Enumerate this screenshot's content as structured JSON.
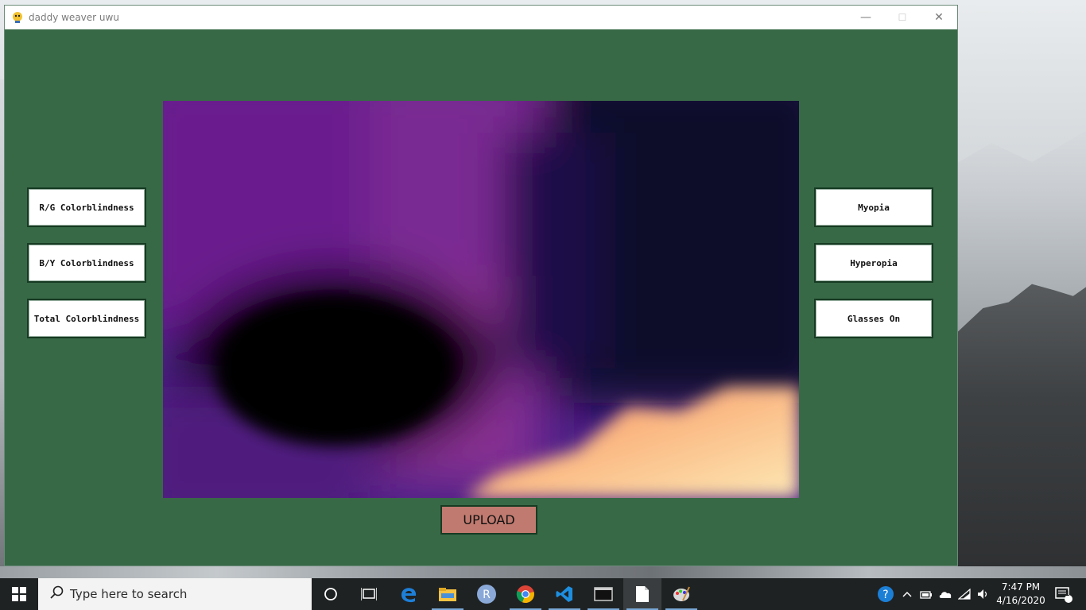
{
  "window": {
    "title": "daddy weaver uwu",
    "controls": {
      "minimize": "—",
      "maximize": "☐",
      "close": "✕"
    }
  },
  "app": {
    "background": "#386947",
    "left_buttons": [
      "R/G Colorblindness",
      "B/Y Colorblindness",
      "Total Colorblindness"
    ],
    "right_buttons": [
      "Myopia",
      "Hyperopia",
      "Glasses On"
    ],
    "upload_label": "UPLOAD",
    "upload_color": "#c07a6f"
  },
  "taskbar": {
    "search_placeholder": "Type here to search",
    "icons": [
      "task-view",
      "multitask",
      "edge",
      "file-explorer",
      "r-app",
      "chrome",
      "vscode",
      "terminal",
      "notepad",
      "paint"
    ],
    "time": "7:47 PM",
    "date": "4/16/2020",
    "notification_count": "1",
    "accent": "#77a7d6"
  }
}
